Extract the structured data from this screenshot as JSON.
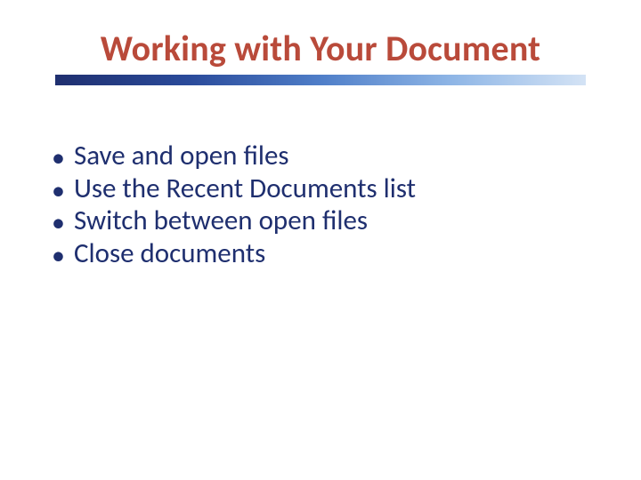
{
  "title": "Working with Your Document",
  "bullets": [
    "Save and open files",
    "Use the Recent Documents list",
    "Switch between open files",
    "Close documents"
  ],
  "colors": {
    "title": "#b94a3a",
    "body": "#1f2f6f"
  }
}
